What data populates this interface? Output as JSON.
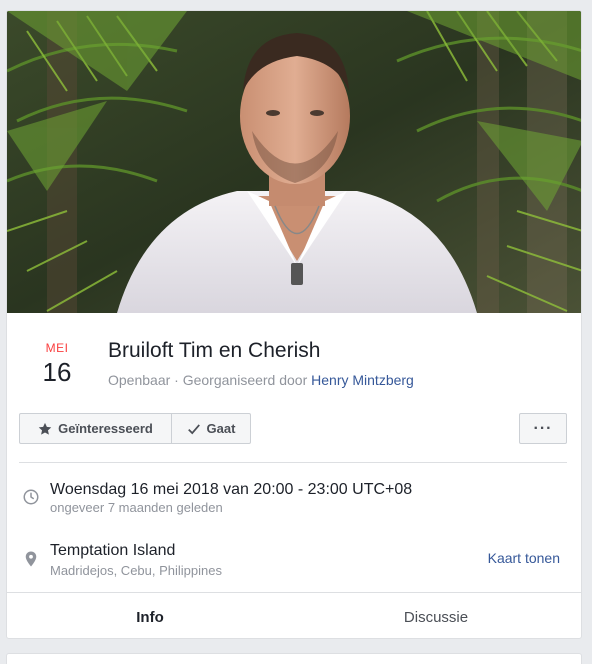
{
  "event": {
    "month": "MEI",
    "day": "16",
    "title": "Bruiloft Tim en Cherish",
    "privacy": "Openbaar",
    "organizer_prefix": " · Georganiseerd door ",
    "organizer": "Henry Mintzberg"
  },
  "actions": {
    "interested_label": "Geïnteresseerd",
    "going_label": "Gaat",
    "more_label": "···"
  },
  "details": {
    "datetime": "Woensdag 16 mei 2018 van 20:00 - 23:00 UTC+08",
    "relative_time": "ongeveer 7 maanden geleden",
    "location_name": "Temptation Island",
    "location_address": "Madridejos, Cebu, Philippines",
    "map_link": "Kaart tonen"
  },
  "tabs": [
    {
      "label": "Info",
      "active": true
    },
    {
      "label": "Discussie",
      "active": false
    }
  ],
  "icons": {
    "interested": "star-icon",
    "going": "checkmark-icon",
    "time": "clock-icon",
    "location": "map-pin-icon"
  },
  "colors": {
    "accent": "#4267b2",
    "link": "#365899",
    "month": "#fa3e3e",
    "muted": "#90949c"
  }
}
